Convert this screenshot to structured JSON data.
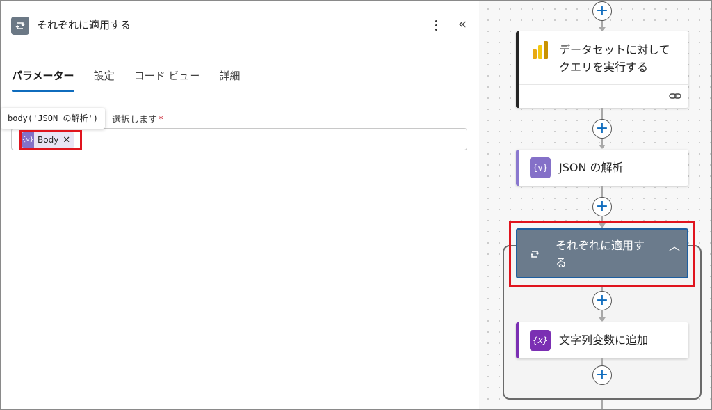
{
  "panel": {
    "title": "それぞれに適用する",
    "tabs": [
      "パラメーター",
      "設定",
      "コード ビュー",
      "詳細"
    ],
    "field_label": "選択します",
    "required_mark": "*",
    "tooltip": "body('JSON_の解析')",
    "token": {
      "label": "Body",
      "remove": "✕",
      "icon": "{v}"
    }
  },
  "canvas": {
    "nodes": [
      {
        "title_line1": "データセットに対して",
        "title_line2": "クエリを実行する",
        "icon": "power-bi-icon",
        "footer_icon": "link-icon"
      },
      {
        "title": "JSON の解析",
        "icon": "{v}"
      },
      {
        "title_line1": "それぞれに適用す",
        "title_line2": "る",
        "icon": "loop-icon"
      },
      {
        "title": "文字列変数に追加",
        "icon": "{x}"
      }
    ]
  },
  "colors": {
    "accent": "#0f6cbd",
    "highlight": "#e0141e",
    "loop_card": "#6b7b8c",
    "variable_icon": "#7b2fb3"
  }
}
